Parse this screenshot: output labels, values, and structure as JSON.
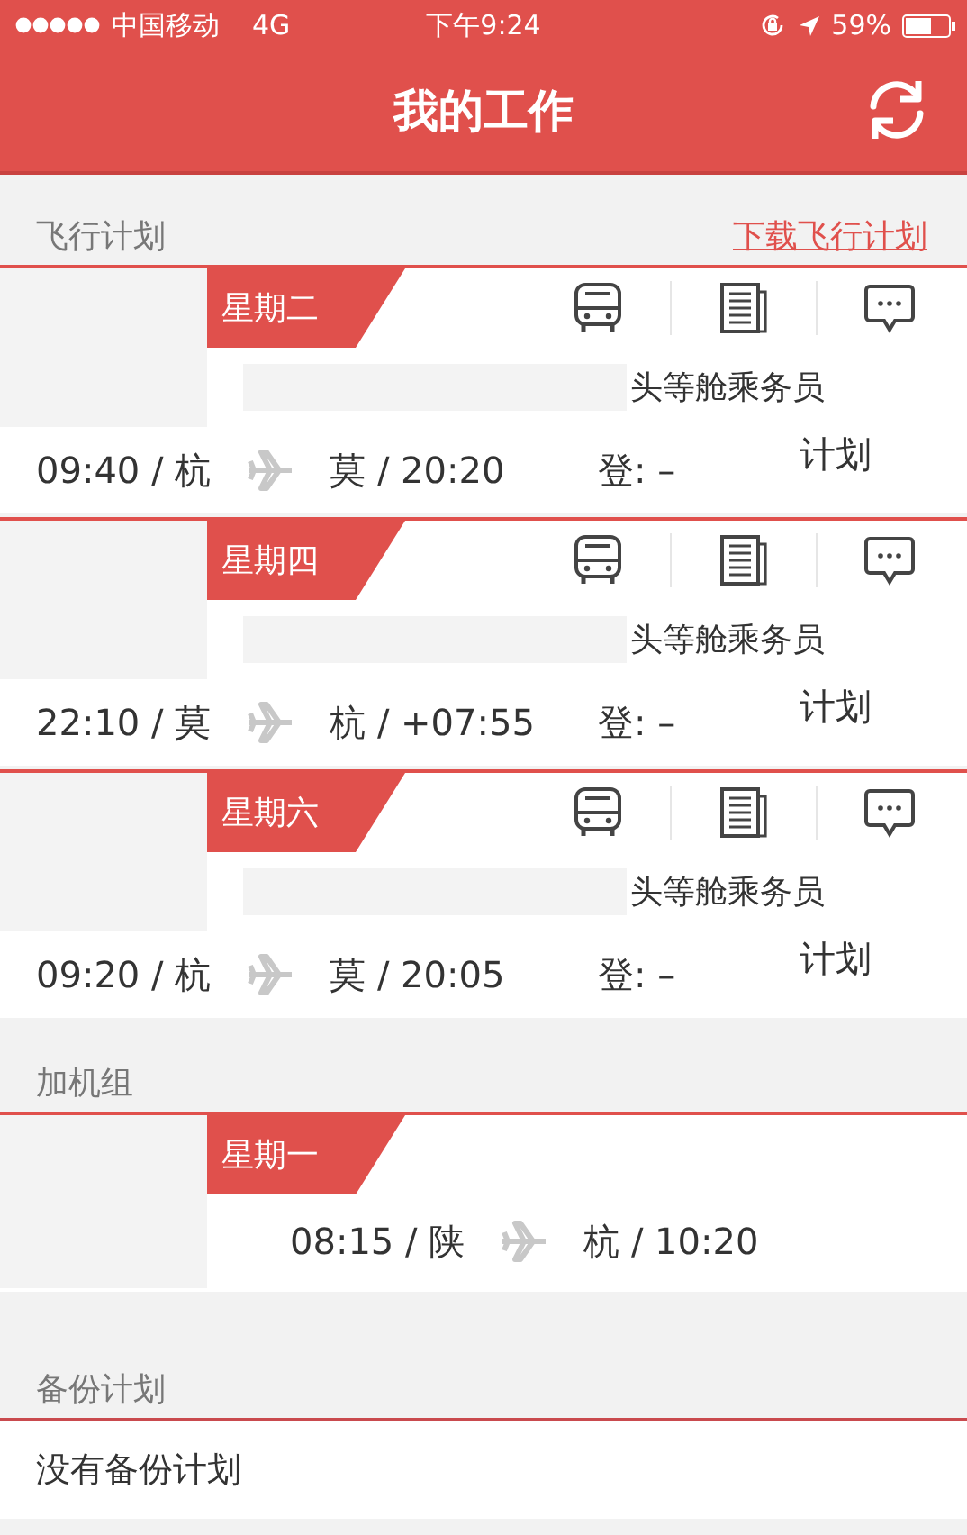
{
  "status_bar": {
    "carrier": "中国移动",
    "network": "4G",
    "time": "下午9:24",
    "battery": "59%"
  },
  "nav": {
    "title": "我的工作"
  },
  "flight_plan": {
    "header": "飞行计划",
    "download_link": "下载飞行计划",
    "cards": [
      {
        "day": "星期二",
        "role": "头等舱乘务员",
        "departure": "09:40 / 杭",
        "arrival": "莫 / 20:20",
        "boarding": "登: –",
        "plan": "计划"
      },
      {
        "day": "星期四",
        "role": "头等舱乘务员",
        "departure": "22:10 / 莫",
        "arrival": "杭 / +07:55",
        "boarding": "登: –",
        "plan": "计划"
      },
      {
        "day": "星期六",
        "role": "头等舱乘务员",
        "departure": "09:20 / 杭",
        "arrival": "莫 / 20:05",
        "boarding": "登: –",
        "plan": "计划"
      }
    ]
  },
  "extra_crew": {
    "header": "加机组",
    "cards": [
      {
        "day": "星期一",
        "departure": "08:15 / 陕",
        "arrival": "杭 / 10:20"
      }
    ]
  },
  "backup_plan": {
    "header": "备份计划",
    "message": "没有备份计划"
  }
}
